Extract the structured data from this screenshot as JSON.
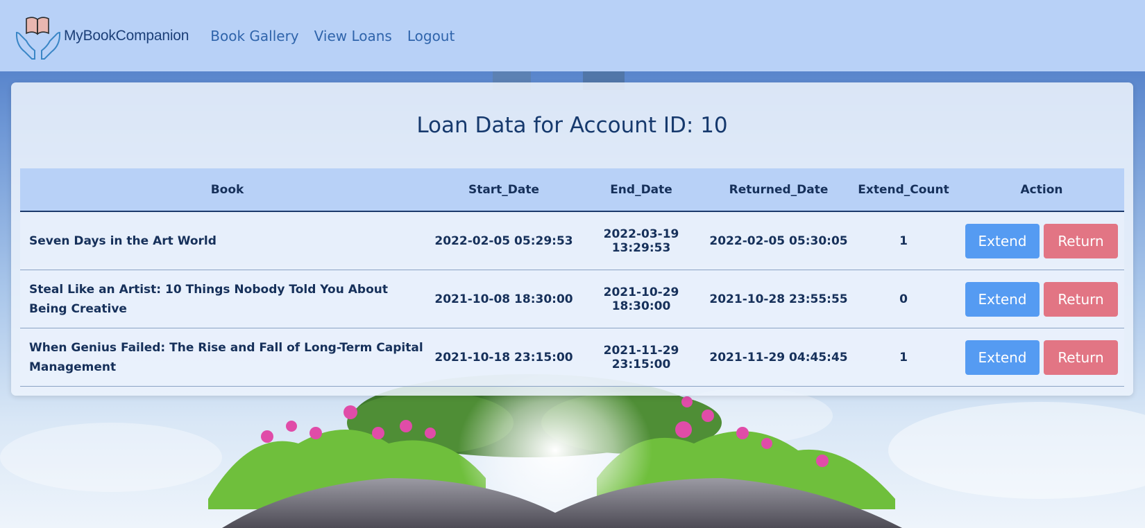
{
  "brand": {
    "name": "MyBookCompanion",
    "logo_icon": "hands-holding-book-icon"
  },
  "nav": {
    "links": [
      "Book Gallery",
      "View Loans",
      "Logout"
    ]
  },
  "page": {
    "title": "Loan Data for Account ID: 10"
  },
  "table": {
    "headers": [
      "Book",
      "Start_Date",
      "End_Date",
      "Returned_Date",
      "Extend_Count",
      "Action"
    ],
    "rows": [
      {
        "book": "Seven Days in the Art World",
        "start": "2022-02-05 05:29:53",
        "end": "2022-03-19 13:29:53",
        "returned": "2022-02-05 05:30:05",
        "extend_count": "1",
        "extend_label": "Extend",
        "return_label": "Return"
      },
      {
        "book": "Steal Like an Artist: 10 Things Nobody Told You About Being Creative",
        "start": "2021-10-08 18:30:00",
        "end": "2021-10-29 18:30:00",
        "returned": "2021-10-28 23:55:55",
        "extend_count": "0",
        "extend_label": "Extend",
        "return_label": "Return"
      },
      {
        "book": "When Genius Failed: The Rise and Fall of Long-Term Capital Management",
        "start": "2021-10-18 23:15:00",
        "end": "2021-11-29 23:15:00",
        "returned": "2021-11-29 04:45:45",
        "extend_count": "1",
        "extend_label": "Extend",
        "return_label": "Return"
      }
    ]
  },
  "colors": {
    "nav_bg": "#b8d1f7",
    "title": "#16396d",
    "extend_button": "#559bf2",
    "return_button": "#e27584",
    "link": "#2f64ab"
  }
}
